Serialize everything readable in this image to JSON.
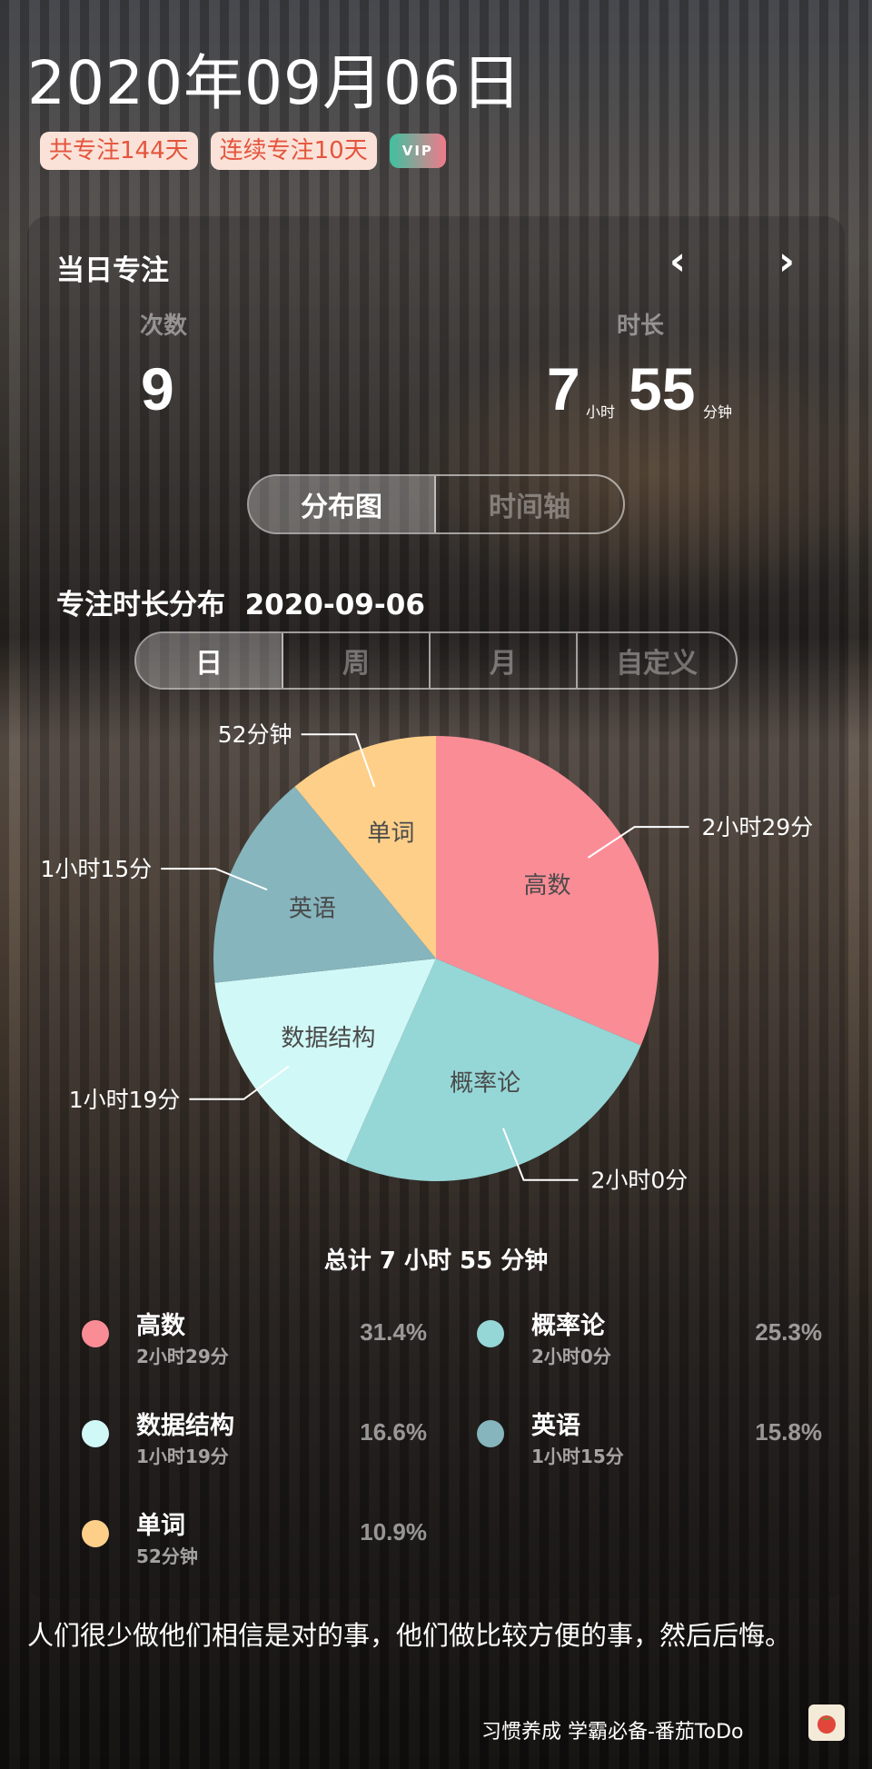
{
  "header": {
    "date": "2020年09月06日",
    "badges": [
      "共专注144天",
      "连续专注10天"
    ],
    "vip_label": "VIP"
  },
  "daily": {
    "title": "当日专注",
    "prev_icon": "chevron-left-icon",
    "next_icon": "chevron-right-icon",
    "count_label": "次数",
    "count_value": "9",
    "duration_label": "时长",
    "hours": "7",
    "hours_unit": "小时",
    "minutes": "55",
    "minutes_unit": "分钟"
  },
  "view_toggle": [
    "分布图",
    "时间轴"
  ],
  "distribution": {
    "title": "专注时长分布",
    "date": "2020-09-06",
    "ranges": [
      "日",
      "周",
      "月",
      "自定义"
    ],
    "total_text": "总计 7 小时 55 分钟"
  },
  "chart_data": {
    "type": "pie",
    "categories": [
      "高数",
      "概率论",
      "数据结构",
      "英语",
      "单词"
    ],
    "values": [
      149,
      120,
      79,
      75,
      52
    ],
    "value_labels": [
      "2小时29分",
      "2小时0分",
      "1小时19分",
      "1小时15分",
      "52分钟"
    ],
    "percentages": [
      "31.4%",
      "25.3%",
      "16.6%",
      "15.8%",
      "10.9%"
    ],
    "colors": [
      "#fa8c96",
      "#95d6d6",
      "#d0f8f6",
      "#86b5bd",
      "#fdcf89"
    ]
  },
  "legend": [
    {
      "name": "高数",
      "time": "2小时29分",
      "pct": "31.4%",
      "color": "#fa8c96"
    },
    {
      "name": "概率论",
      "time": "2小时0分",
      "pct": "25.3%",
      "color": "#95d6d6"
    },
    {
      "name": "数据结构",
      "time": "1小时19分",
      "pct": "16.6%",
      "color": "#d0f8f6"
    },
    {
      "name": "英语",
      "time": "1小时15分",
      "pct": "15.8%",
      "color": "#86b5bd"
    },
    {
      "name": "单词",
      "time": "52分钟",
      "pct": "10.9%",
      "color": "#fdcf89"
    }
  ],
  "quote": "人们很少做他们相信是对的事，他们做比较方便的事，然后后悔。",
  "footer": {
    "brand": "习惯养成 学霸必备-番茄ToDo",
    "logo_icon": "tomato-icon"
  }
}
